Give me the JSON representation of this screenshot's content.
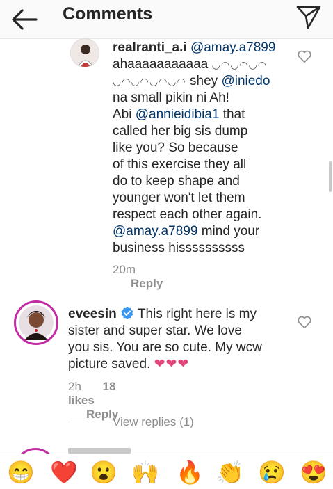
{
  "header": {
    "title": "Comments",
    "back_icon": "arrow-left-icon",
    "send_icon": "paper-plane-icon"
  },
  "comments": [
    {
      "username": "realranti_a.i",
      "mention_to": "@amay.a7899",
      "text_1": "ahaaaaaaaaaaa",
      "dots_1": "◡◠◡◠◡◠",
      "dots_2": "◡◠◡◠◡◠◡◠",
      "text_2": "shey",
      "mention_2": "@iniedo",
      "text_3": "na small pikin ni  Ah!",
      "text_4": "Abi",
      "mention_3": "@annieidibia1",
      "text_5": "that",
      "text_6": "called her big sis dump",
      "text_7": "like you?  So because",
      "text_8": "of this exercise they all",
      "text_9": "do to keep shape and",
      "text_10": "younger won't let them",
      "text_11": "respect each other again.",
      "mention_4": "@amay.a7899",
      "text_12": "mind your",
      "text_13": "business  hissssssssss",
      "time": "20m",
      "reply_label": "Reply"
    },
    {
      "username": "eveesin",
      "verified": true,
      "text_1": "This right here is my",
      "text_2": "sister and super star. We love",
      "text_3": "you sis. You are so cute. My wcw",
      "text_4": "picture saved.",
      "hearts": "❤❤❤",
      "time": "2h",
      "likes": "18 likes",
      "reply_label": "Reply"
    }
  ],
  "view_replies": "View replies (1)",
  "emoji_bar": [
    "😁",
    "❤️",
    "😮",
    "🙌",
    "🔥",
    "👏",
    "😢",
    "😍"
  ],
  "colors": {
    "accent_blue": "#3897f0",
    "mention": "#003569",
    "heart_pink": "#e0457b",
    "story_ring": "#c32aa3"
  }
}
